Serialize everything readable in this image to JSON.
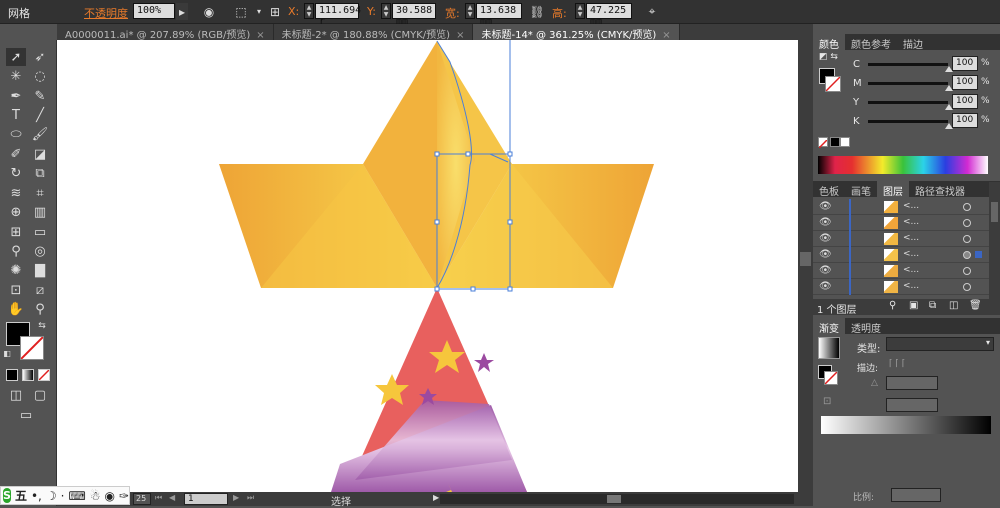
{
  "control_bar": {
    "mode_label": "网格",
    "opacity_label": "不透明度",
    "opacity_value": "100%",
    "x_label": "X:",
    "x_value": "111.694 r",
    "y_label": "Y:",
    "y_value": "30.588 mm",
    "w_label": "宽:",
    "w_value": "13.638 mm",
    "h_label": "高:",
    "h_value": "47.225 mm"
  },
  "tabs": [
    {
      "label": "A0000011.ai* @ 207.89% (RGB/预览)",
      "active": false
    },
    {
      "label": "未标题-2* @ 180.88% (CMYK/预览)",
      "active": false
    },
    {
      "label": "未标题-14* @ 361.25% (CMYK/预览)",
      "active": true
    }
  ],
  "tab_close_glyph": "×",
  "status_bar": {
    "zoom_value": "25",
    "page_value": "1",
    "tool_label": "选择"
  },
  "ime": {
    "logo": "S",
    "mode": "五"
  },
  "color_panel": {
    "tabs": [
      "颜色",
      "颜色参考",
      "描边"
    ],
    "channels": [
      {
        "label": "C",
        "value": "100",
        "unit": "%"
      },
      {
        "label": "M",
        "value": "100",
        "unit": "%"
      },
      {
        "label": "Y",
        "value": "100",
        "unit": "%"
      },
      {
        "label": "K",
        "value": "100",
        "unit": "%"
      }
    ]
  },
  "layers_panel": {
    "tabs": [
      "色板",
      "画笔",
      "图层",
      "路径查找器"
    ],
    "rows": [
      {
        "name": "<...",
        "thumb": "#f3b03d"
      },
      {
        "name": "<...",
        "thumb": "#f0a43a"
      },
      {
        "name": "<...",
        "thumb": "#f2b842"
      },
      {
        "name": "<...",
        "thumb": "#f3c24a"
      },
      {
        "name": "<...",
        "thumb": "#ecab40"
      },
      {
        "name": "<...",
        "thumb": "#f0b445"
      }
    ],
    "count_label": "1 个图层"
  },
  "gradient_panel": {
    "tabs": [
      "渐变",
      "透明度"
    ],
    "type_label": "类型:",
    "stroke_label": "描边:",
    "angle_glyph": "△",
    "aspect_label": "比例:"
  },
  "icons": [
    "select-icon",
    "direct-select-icon",
    "magic-wand-icon",
    "lasso-icon",
    "pen-icon",
    "type-icon",
    "line-icon",
    "ellipse-icon",
    "brush-icon",
    "pencil-icon",
    "eraser-icon",
    "rotate-icon",
    "scale-icon",
    "warp-icon",
    "free-transform-icon",
    "shape-builder-icon",
    "mesh-icon",
    "gradient-icon",
    "eyedropper-icon",
    "blend-icon",
    "symbol-sprayer-icon",
    "graph-icon",
    "artboard-icon",
    "slice-icon",
    "hand-icon",
    "zoom-icon"
  ],
  "colors": {
    "star_yellow": "#f6c63c",
    "star_orange": "#eda035",
    "tree_red": "#e8605e",
    "ribbon_purple": "#a55fae",
    "small_star_purple": "#9b4aa0",
    "accent_blue": "#3b66c4"
  }
}
